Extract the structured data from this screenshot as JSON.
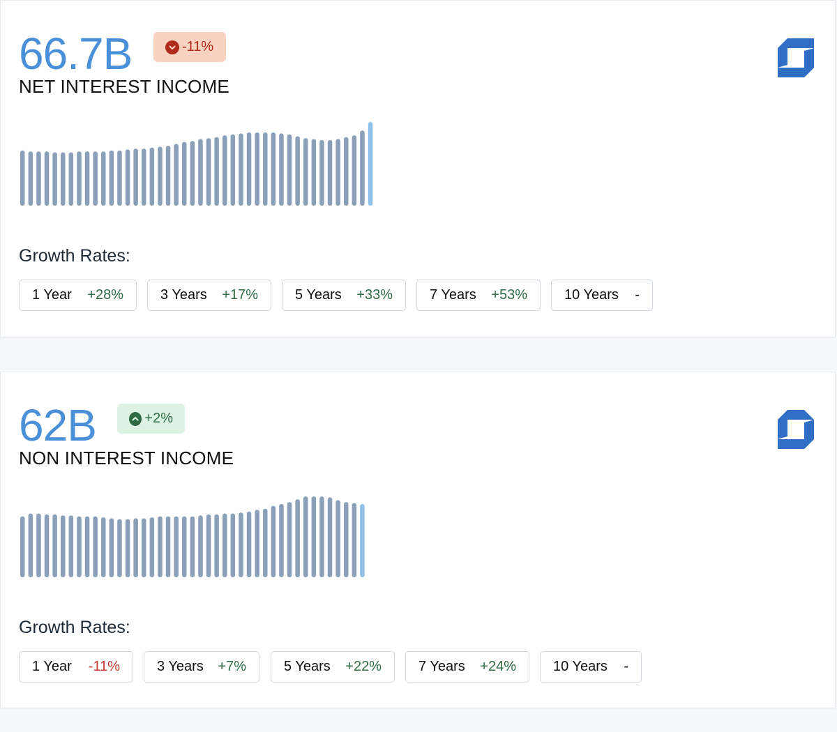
{
  "cards": [
    {
      "value": "66.7B",
      "change": "-11%",
      "change_direction": "down",
      "label": "NET INTEREST INCOME",
      "logo_icon": "chase-octagon-logo-icon",
      "growth_heading": "Growth Rates:",
      "growth_rates": [
        {
          "period": "1 Year",
          "rate": "+28%",
          "sign": "pos"
        },
        {
          "period": "3 Years",
          "rate": "+17%",
          "sign": "pos"
        },
        {
          "period": "5 Years",
          "rate": "+33%",
          "sign": "pos"
        },
        {
          "period": "7 Years",
          "rate": "+53%",
          "sign": "pos"
        },
        {
          "period": "10 Years",
          "rate": "-",
          "sign": "none"
        }
      ]
    },
    {
      "value": "62B",
      "change": "+2%",
      "change_direction": "up",
      "label": "NON INTEREST INCOME",
      "logo_icon": "chase-octagon-logo-icon",
      "growth_heading": "Growth Rates:",
      "growth_rates": [
        {
          "period": "1 Year",
          "rate": "-11%",
          "sign": "neg"
        },
        {
          "period": "3 Years",
          "rate": "+7%",
          "sign": "pos"
        },
        {
          "period": "5 Years",
          "rate": "+22%",
          "sign": "pos"
        },
        {
          "period": "7 Years",
          "rate": "+24%",
          "sign": "pos"
        },
        {
          "period": "10 Years",
          "rate": "-",
          "sign": "none"
        }
      ]
    }
  ],
  "colors": {
    "bar": "#8a9fb8",
    "bar_latest": "#8fc0ea",
    "value_blue": "#4a90d9",
    "logo_blue": "#2f6fc6"
  },
  "chart_data": [
    {
      "type": "bar",
      "series_note_color_latest": "#8fc0ea",
      "values": [
        58,
        57,
        57,
        57,
        56,
        56,
        56,
        57,
        57,
        57,
        57,
        58,
        58,
        59,
        60,
        60,
        61,
        62,
        63,
        65,
        67,
        68,
        70,
        71,
        72,
        74,
        75,
        76,
        77,
        77,
        77,
        77,
        76,
        75,
        73,
        71,
        70,
        69,
        69,
        70,
        72,
        74,
        79,
        88
      ]
    },
    {
      "type": "bar",
      "values": [
        64,
        67,
        67,
        66,
        66,
        65,
        65,
        64,
        64,
        64,
        63,
        62,
        61,
        61,
        62,
        62,
        63,
        64,
        64,
        64,
        64,
        64,
        65,
        66,
        66,
        67,
        67,
        68,
        69,
        71,
        72,
        75,
        77,
        79,
        82,
        85,
        85,
        85,
        84,
        81,
        79,
        78,
        77
      ]
    }
  ]
}
